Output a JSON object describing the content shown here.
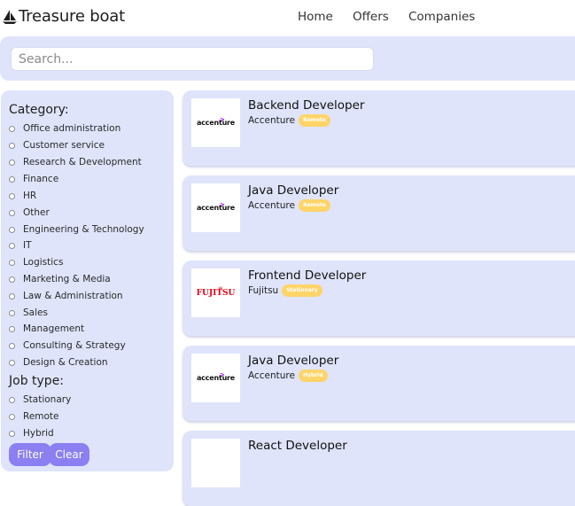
{
  "header": {
    "brand": "Treasure boat",
    "nav": [
      "Home",
      "Offers",
      "Companies"
    ]
  },
  "search": {
    "placeholder": "Search..."
  },
  "filters": {
    "category_title": "Category:",
    "categories": [
      "Office administration",
      "Customer service",
      "Research & Development",
      "Finance",
      "HR",
      "Other",
      "Engineering & Technology",
      "IT",
      "Logistics",
      "Marketing & Media",
      "Law & Administration",
      "Sales",
      "Management",
      "Consulting & Strategy",
      "Design & Creation"
    ],
    "jobtype_title": "Job type:",
    "job_types": [
      "Stationary",
      "Remote",
      "Hybrid"
    ],
    "filter_button": "Filter",
    "clear_button": "Clear"
  },
  "offers": [
    {
      "title": "Backend Developer",
      "company": "Accenture",
      "badge": "Remote",
      "logo": "accenture"
    },
    {
      "title": "Java Developer",
      "company": "Accenture",
      "badge": "Remote",
      "logo": "accenture"
    },
    {
      "title": "Frontend Developer",
      "company": "Fujitsu",
      "badge": "Stationary",
      "logo": "FUJITSU"
    },
    {
      "title": "Java Developer",
      "company": "Accenture",
      "badge": "Hybrid",
      "logo": "accenture"
    },
    {
      "title": "React Developer",
      "company": "",
      "badge": "",
      "logo": ""
    }
  ],
  "colors": {
    "panel": "#dfe4fb",
    "badge": "#ffd468",
    "button": "#8b7ff1"
  }
}
